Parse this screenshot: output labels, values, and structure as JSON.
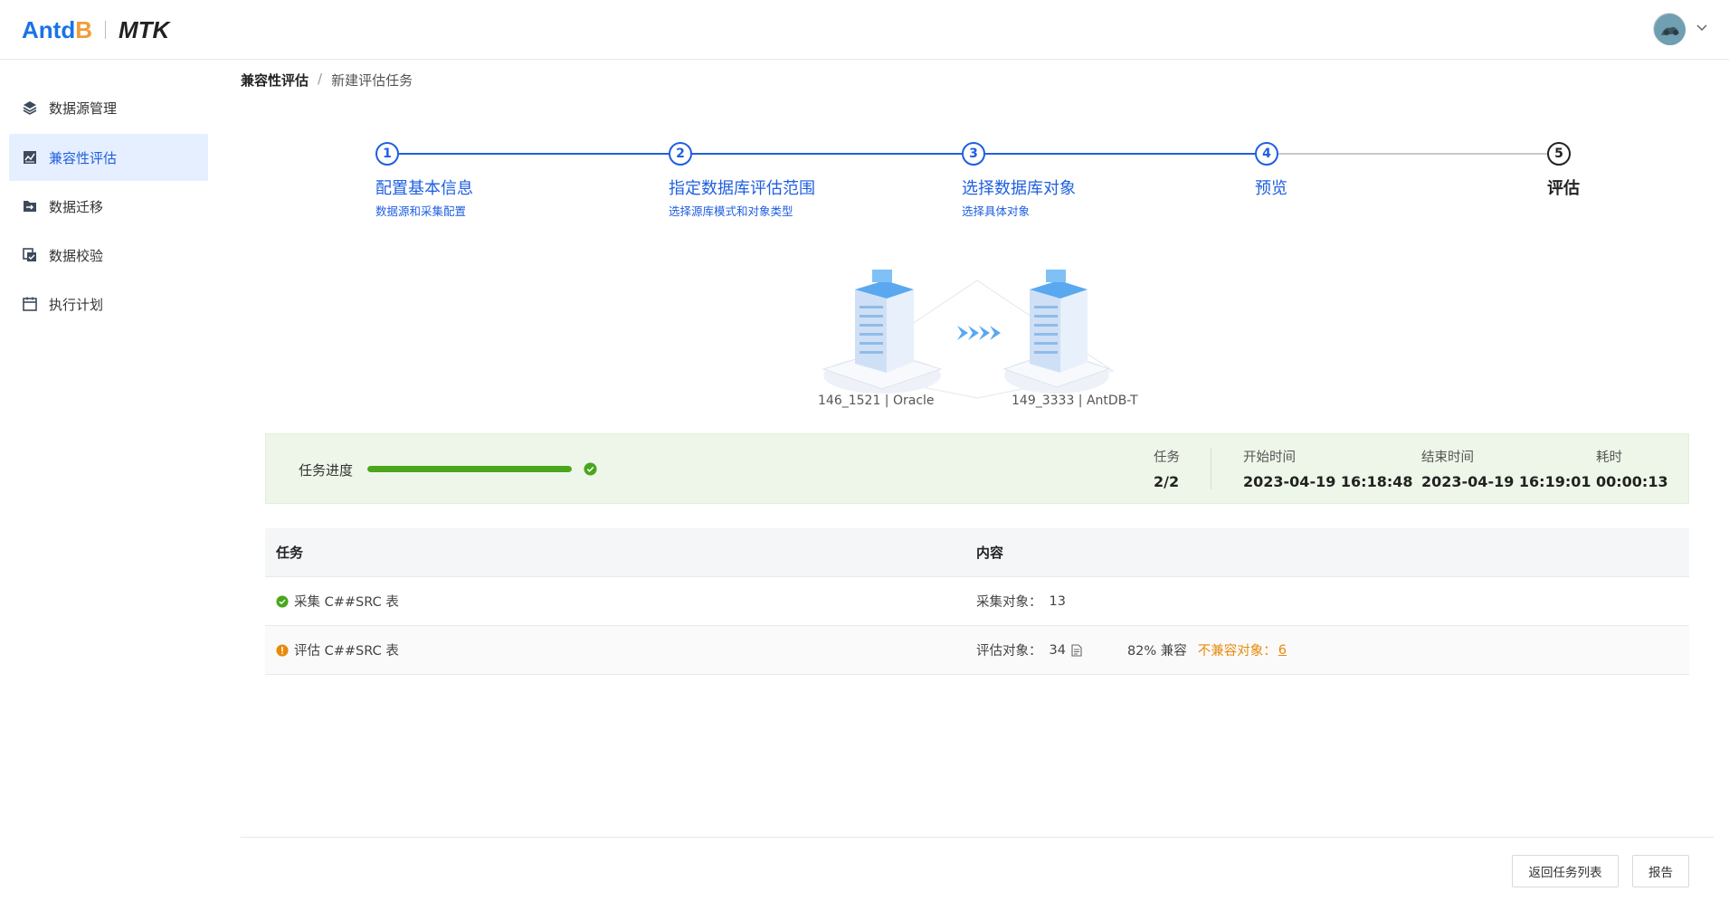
{
  "header": {
    "logo_antdb_prefix": "Antd",
    "logo_antdb_suffix": "B",
    "logo_product": "MTK",
    "avatar_icon": "user-avatar"
  },
  "sidebar": {
    "items": [
      {
        "label": "数据源管理",
        "icon": "layers-icon"
      },
      {
        "label": "兼容性评估",
        "icon": "chart-icon"
      },
      {
        "label": "数据迁移",
        "icon": "migrate-icon"
      },
      {
        "label": "数据校验",
        "icon": "copy-check-icon"
      },
      {
        "label": "执行计划",
        "icon": "calendar-icon"
      }
    ],
    "active_index": 1
  },
  "breadcrumb": {
    "parent": "兼容性评估",
    "separator": "/",
    "current": "新建评估任务"
  },
  "steps": [
    {
      "num": "1",
      "title": "配置基本信息",
      "desc": "数据源和采集配置"
    },
    {
      "num": "2",
      "title": "指定数据库评估范围",
      "desc": "选择源库模式和对象类型"
    },
    {
      "num": "3",
      "title": "选择数据库对象",
      "desc": "选择具体对象"
    },
    {
      "num": "4",
      "title": "预览",
      "desc": ""
    },
    {
      "num": "5",
      "title": "评估",
      "desc": ""
    }
  ],
  "illustration": {
    "source_label": "146_1521 | Oracle",
    "target_label": "149_3333 | AntDB-T"
  },
  "progress": {
    "label": "任务进度",
    "fraction": 1.0,
    "stats": [
      {
        "key": "任务",
        "value": "2/2"
      },
      {
        "key": "开始时间",
        "value": "2023-04-19 16:18:48"
      },
      {
        "key": "结束时间",
        "value": "2023-04-19 16:19:01"
      },
      {
        "key": "耗时",
        "value": "00:00:13"
      }
    ],
    "colors": {
      "bar": "#4aa61c",
      "panel": "#eef6e9"
    }
  },
  "table": {
    "headers": [
      "任务",
      "内容"
    ],
    "rows": [
      {
        "status": "success",
        "task": "采集 C##SRC 表",
        "content_label": "采集对象：",
        "content_value": "13"
      },
      {
        "status": "warning",
        "task": "评估 C##SRC 表",
        "content_label": "评估对象：",
        "content_value": "34",
        "compat": "82% 兼容",
        "incompat_label": "不兼容对象：",
        "incompat_value": "6"
      }
    ]
  },
  "footer": {
    "back_button": "返回任务列表",
    "report_button": "报告"
  },
  "colors": {
    "accent": "#1f5fe0",
    "warning": "#e88a0c",
    "success": "#4aa61c"
  }
}
